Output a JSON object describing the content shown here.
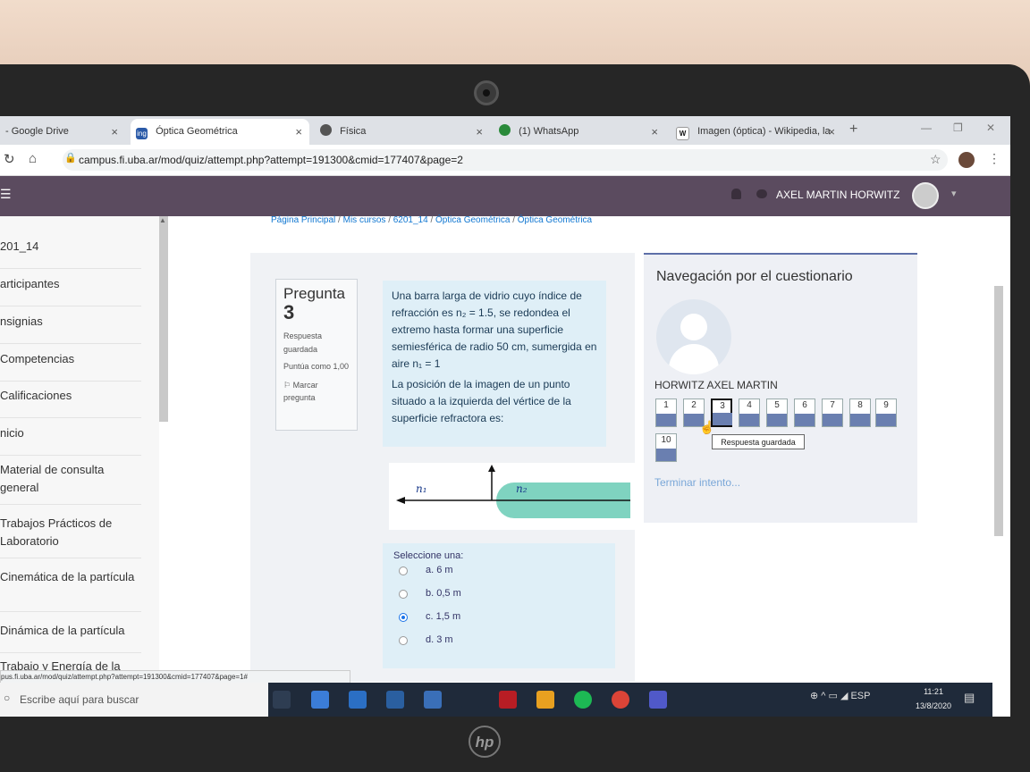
{
  "browser": {
    "tabs": [
      {
        "title": "- Google Drive"
      },
      {
        "title": "Óptica Geométrica"
      },
      {
        "title": "Física"
      },
      {
        "title": "(1) WhatsApp"
      },
      {
        "title": "Imagen (óptica) - Wikipedia, la"
      }
    ],
    "tab_favicons": [
      "",
      "ing",
      "",
      "",
      "W"
    ],
    "url": "campus.fi.uba.ar/mod/quiz/attempt.php?attempt=191300&cmid=177407&page=2",
    "status_url": "pus.fi.uba.ar/mod/quiz/attempt.php?attempt=191300&cmid=177407&page=1#"
  },
  "header": {
    "username": "AXEL MARTIN HORWITZ"
  },
  "sidebar": {
    "items": [
      {
        "label": "201_14"
      },
      {
        "label": "articipantes"
      },
      {
        "label": "nsignias"
      },
      {
        "label": "Competencias"
      },
      {
        "label": "Calificaciones"
      },
      {
        "label": "nicio"
      },
      {
        "label": "Material de consulta general"
      },
      {
        "label": "Trabajos Prácticos de Laboratorio"
      },
      {
        "label": "Cinemática de la partícula"
      },
      {
        "label": "Dinámica de la partícula"
      },
      {
        "label": "Trabajo y Energía de la"
      }
    ]
  },
  "breadcrumb": {
    "items": [
      "Página Principal",
      "Mis cursos",
      "6201_14",
      "Óptica Geométrica",
      "Óptica Geométrica"
    ],
    "separator": "/"
  },
  "question": {
    "label": "Pregunta",
    "number": "3",
    "state": "Respuesta guardada",
    "score": "Puntúa como 1,00",
    "flag_label": "Marcar pregunta",
    "text_p1": "Una barra larga de vidrio cuyo índice de refracción es n₂ = 1.5, se redondea el extremo hasta formar una superficie semiesférica de radio 50 cm, sumergida en aire n₁ = 1",
    "text_p2": "La posición de la imagen de un punto situado a la izquierda del vértice de la superficie refractora es:",
    "diagram_n1": "n₁",
    "diagram_n2": "n₂",
    "select_label": "Seleccione una:",
    "options": [
      {
        "text": "a. 6 m",
        "selected": false
      },
      {
        "text": "b. 0,5 m",
        "selected": false
      },
      {
        "text": "c. 1,5 m",
        "selected": true
      },
      {
        "text": "d. 3 m",
        "selected": false
      }
    ]
  },
  "quiz_nav": {
    "title": "Navegación por el cuestionario",
    "student_name": "HORWITZ AXEL MARTIN",
    "buttons": [
      "1",
      "2",
      "3",
      "4",
      "5",
      "6",
      "7",
      "8",
      "9",
      "10"
    ],
    "current": "3",
    "tooltip": "Respuesta guardada",
    "finish_link": "Terminar intento..."
  },
  "taskbar": {
    "search_placeholder": "Escribe aquí para buscar",
    "language": "ESP",
    "time": "11:21",
    "date": "13/8/2020"
  },
  "colors": {
    "moodle_header": "#5b4b5f",
    "question_bg": "#dfeff7",
    "nav_fill": "#6a7fb0",
    "link": "#1177d1",
    "diagram_glass": "#7fd3c0"
  }
}
